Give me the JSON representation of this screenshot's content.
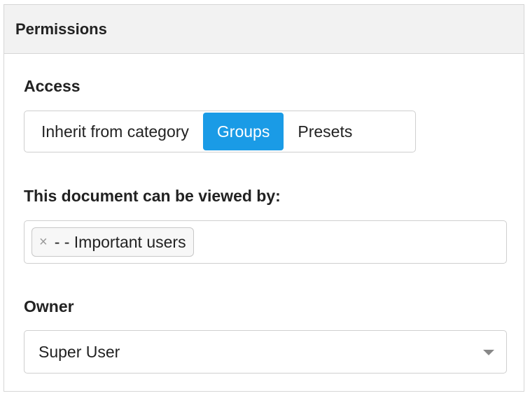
{
  "panel": {
    "title": "Permissions"
  },
  "access": {
    "label": "Access",
    "options": [
      "Inherit from category",
      "Groups",
      "Presets"
    ],
    "selected": "Groups",
    "accent_color": "#1a9be6"
  },
  "viewers": {
    "label": "This document can be viewed by:",
    "tags": [
      {
        "remove_glyph": "×",
        "text": "- - Important users"
      }
    ]
  },
  "owner": {
    "label": "Owner",
    "value": "Super User",
    "icon": "chevron-down-icon"
  }
}
